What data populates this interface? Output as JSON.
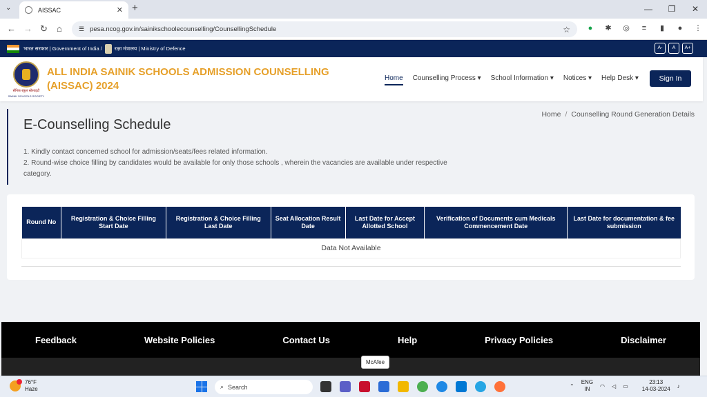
{
  "browser": {
    "tab_title": "AISSAC",
    "tab_close": "✕",
    "new_tab": "+",
    "url": "pesa.ncog.gov.in/sainikschoolecounselling/CounsellingSchedule"
  },
  "gov_bar": {
    "hindi_govt": "भारत सरकार | Government of India /",
    "hindi_ministry": "रक्षा मंत्रालय | Ministry of Defence",
    "font_buttons": [
      "A-",
      "A",
      "A+"
    ]
  },
  "header": {
    "logo_text": "सैनिक स्कूल सोसाइटी",
    "logo_subtext": "SAINIK SCHOOLS SOCIETY",
    "title_line1": "ALL INDIA SAINIK SCHOOLS ADMISSION COUNSELLING",
    "title_line2": "(AISSAC) 2024",
    "menu": {
      "home": "Home",
      "counselling": "Counselling Process ▾",
      "school_info": "School Information ▾",
      "notices": "Notices ▾",
      "helpdesk": "Help Desk ▾"
    },
    "sign_in": "Sign In"
  },
  "page": {
    "title": "E-Counselling Schedule",
    "note1": "1. Kindly contact concerned school for admission/seats/fees related information.",
    "note2": "2. Round-wise choice filling by candidates would be available for only those schools , wherein the vacancies are available under respective category.",
    "breadcrumb_home": "Home",
    "breadcrumb_sep": "/",
    "breadcrumb_current": "Counselling Round Generation Details"
  },
  "table": {
    "headers": [
      "Round No",
      "Registration & Choice Filling Start Date",
      "Registration & Choice Filling Last Date",
      "Seat Allocation Result Date",
      "Last Date for Accept Allotted School",
      "Verification of Documents cum Medicals Commencement Date",
      "Last Date for documentation & fee submission"
    ],
    "empty_message": "Data Not Available"
  },
  "footer": {
    "links": [
      "Feedback",
      "Website Policies",
      "Contact Us",
      "Help",
      "Privacy Policies",
      "Disclaimer"
    ]
  },
  "tooltip": "McAfee",
  "taskbar": {
    "temp": "76°F",
    "weather": "Haze",
    "search": "Search",
    "lang1": "ENG",
    "lang2": "IN",
    "time": "23:13",
    "date": "14-03-2024"
  }
}
